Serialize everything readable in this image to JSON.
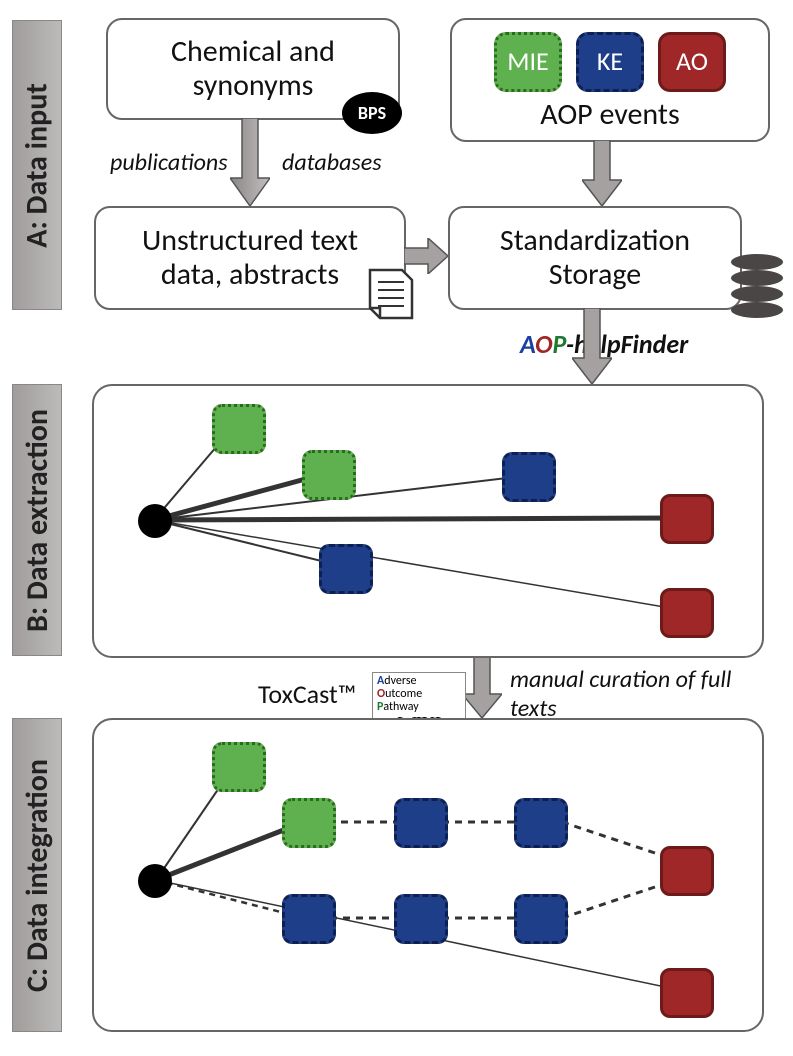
{
  "sections": {
    "a": "A: Data input",
    "b": "B: Data extraction",
    "c": "C: Data integration"
  },
  "boxes": {
    "chem": "Chemical and\nsynonyms",
    "unstr": "Unstructured text\ndata, abstracts",
    "std": "Standardization\nStorage",
    "aop_title": "AOP events"
  },
  "events": {
    "mie": "MIE",
    "ke": "KE",
    "ao": "AO"
  },
  "bps": "BPS",
  "labels": {
    "pub": "publications",
    "db": "databases",
    "tox": "ToxCast™",
    "mcur": "manual curation of full texts"
  },
  "aoph": {
    "a": "A",
    "o": "O",
    "p": "P",
    "rest": "-helpFinder"
  },
  "wiki": {
    "a": "A",
    "o": "O",
    "p": "P",
    "dverse": "dverse",
    "utcome": "utcome",
    "athway": "athway",
    "wk": "WIKI"
  }
}
